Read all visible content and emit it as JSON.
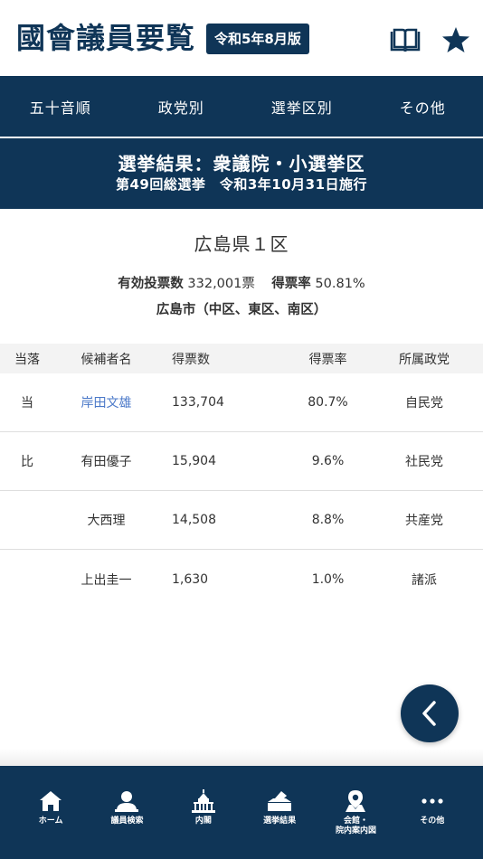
{
  "header": {
    "title": "國會議員要覧",
    "edition": "令和5年8月版",
    "icons": [
      "book-icon",
      "star-icon"
    ]
  },
  "nav": {
    "items": [
      "五十音順",
      "政党別",
      "選挙区別",
      "その他"
    ]
  },
  "banner": {
    "title": "選挙結果：衆議院・小選挙区",
    "subtitle": "第49回総選挙　令和3年10月31日施行"
  },
  "district": {
    "name": "広島県１区",
    "turnout_label": "有効投票数",
    "turnout_value": "332,001票",
    "rate_label": "得票率",
    "rate_value": "50.81%",
    "area": "広島市（中区、東区、南区）"
  },
  "table": {
    "headers": [
      "当落",
      "候補者名",
      "得票数",
      "得票率",
      "所属政党"
    ],
    "rows": [
      {
        "result": "当",
        "name": "岸田文雄",
        "votes": "133,704",
        "rate": "80.7%",
        "party": "自民党"
      },
      {
        "result": "比",
        "name": "有田優子",
        "votes": "15,904",
        "rate": "9.6%",
        "party": "社民党"
      },
      {
        "result": "",
        "name": "大西理",
        "votes": "14,508",
        "rate": "8.8%",
        "party": "共産党"
      },
      {
        "result": "",
        "name": "上出圭一",
        "votes": "1,630",
        "rate": "1.0%",
        "party": "諸派"
      }
    ]
  },
  "bottom_tabs": [
    {
      "label": "ホーム",
      "icon": "home-icon"
    },
    {
      "label": "議員検索",
      "icon": "person-search-icon"
    },
    {
      "label": "内閣",
      "icon": "diet-building-icon"
    },
    {
      "label": "選挙結果",
      "icon": "ballot-box-icon"
    },
    {
      "label": "会館・\n院内案内図",
      "icon": "map-pin-icon"
    },
    {
      "label": "その他",
      "icon": "more-icon"
    }
  ],
  "colors": {
    "primary": "#0f3557",
    "link": "#4a78c8"
  }
}
